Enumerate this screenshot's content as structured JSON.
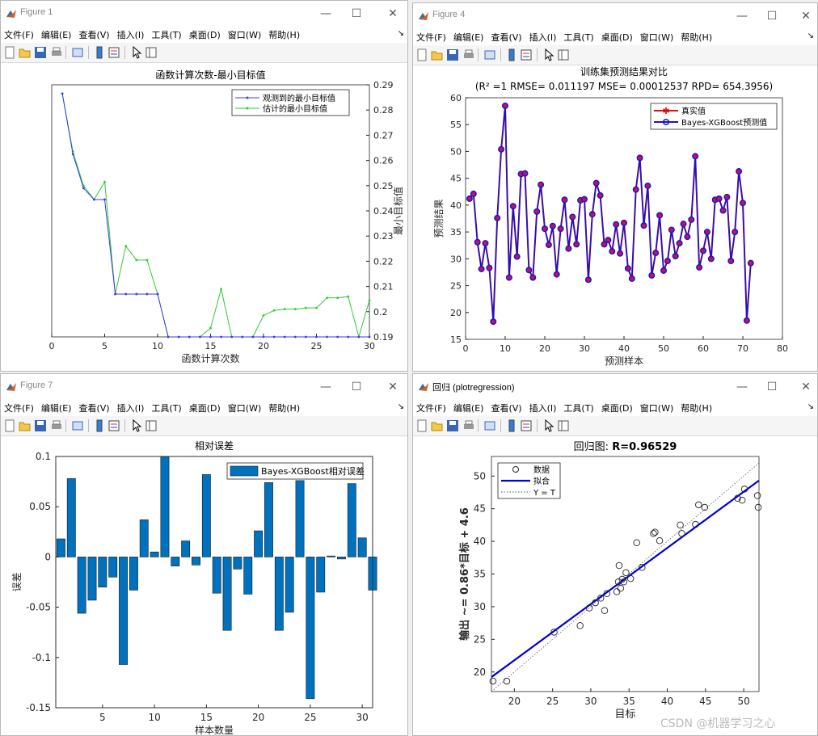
{
  "menu": [
    "文件(F)",
    "编辑(E)",
    "查看(V)",
    "插入(I)",
    "工具(T)",
    "桌面(D)",
    "窗口(W)",
    "帮助(H)"
  ],
  "window_controls": {
    "minimize": "—",
    "maximize": "☐",
    "close": "✕"
  },
  "figure1": {
    "window_title": "Figure 1",
    "chart_data": {
      "type": "line",
      "title": "函数计算次数-最小目标值",
      "xlabel": "函数计算次数",
      "ylabel": "最小目标值",
      "xlim": [
        0,
        30
      ],
      "ylim": [
        0.19,
        0.29
      ],
      "x_ticks": [
        "0",
        "5",
        "10",
        "15",
        "20",
        "25",
        "30"
      ],
      "y_ticks": [
        "0.19",
        "0.2",
        "0.21",
        "0.22",
        "0.23",
        "0.24",
        "0.25",
        "0.26",
        "0.27",
        "0.28",
        "0.29"
      ],
      "y_axis_side": "right",
      "legend_position": "top-right",
      "series": [
        {
          "name": "观测到的最小目标值",
          "color": "#3b3bf0",
          "marker": "dot",
          "x": [
            1,
            2,
            3,
            4,
            5,
            6,
            7,
            8,
            9,
            10,
            11,
            12,
            13,
            14,
            15,
            16,
            17,
            18,
            19,
            20,
            21,
            22,
            23,
            24,
            25,
            26,
            27,
            28,
            29,
            30
          ],
          "values": [
            0.2865,
            0.2625,
            0.249,
            0.2445,
            0.2445,
            0.207,
            0.207,
            0.207,
            0.207,
            0.207,
            0.19,
            0.19,
            0.19,
            0.19,
            0.19,
            0.19,
            0.19,
            0.19,
            0.19,
            0.19,
            0.19,
            0.19,
            0.19,
            0.19,
            0.19,
            0.19,
            0.19,
            0.19,
            0.19,
            0.19
          ]
        },
        {
          "name": "估计的最小目标值",
          "color": "#2ecc2e",
          "marker": "dot",
          "x": [
            1,
            2,
            3,
            4,
            5,
            6,
            7,
            8,
            9,
            10,
            11,
            12,
            13,
            14,
            15,
            16,
            17,
            18,
            19,
            20,
            21,
            22,
            23,
            24,
            25,
            26,
            27,
            28,
            29,
            30
          ],
          "values": [
            0.2865,
            0.2635,
            0.25,
            0.2445,
            0.2515,
            0.207,
            0.226,
            0.2205,
            0.2205,
            0.207,
            0.19,
            0.19,
            0.19,
            0.19,
            0.1935,
            0.209,
            0.19,
            0.19,
            0.19,
            0.1985,
            0.2005,
            0.201,
            0.201,
            0.2015,
            0.2015,
            0.2055,
            0.2055,
            0.206,
            0.19,
            0.2045
          ]
        }
      ]
    }
  },
  "figure4": {
    "window_title": "Figure 4",
    "chart_data": {
      "type": "line",
      "title": "训练集预测结果对比",
      "subtitle": "(R² =1 RMSE= 0.011197 MSE= 0.00012537 RPD= 654.3956)",
      "xlabel": "预测样本",
      "ylabel": "预测结果",
      "xlim": [
        0,
        80
      ],
      "ylim": [
        15,
        60
      ],
      "x_ticks": [
        "0",
        "10",
        "20",
        "30",
        "40",
        "50",
        "60",
        "70",
        "80"
      ],
      "y_ticks": [
        "15",
        "20",
        "25",
        "30",
        "35",
        "40",
        "45",
        "50",
        "55",
        "60"
      ],
      "legend_position": "top-right",
      "series": [
        {
          "name": "真实值",
          "color": "#e01010",
          "marker": "star"
        },
        {
          "name": "Bayes-XGBoost预测值",
          "color": "#1515d0",
          "marker": "circle"
        }
      ],
      "values": [
        41.2,
        42.1,
        33.1,
        28.1,
        32.9,
        28.3,
        18.3,
        37.6,
        50.4,
        58.5,
        26.5,
        39.8,
        30.4,
        45.8,
        45.9,
        27.9,
        26.5,
        38.8,
        43.8,
        35.6,
        32.6,
        36.1,
        27.1,
        35.6,
        41.0,
        31.9,
        37.8,
        32.7,
        40.9,
        41.1,
        26.1,
        38.3,
        44.1,
        41.8,
        32.7,
        33.5,
        31.4,
        36.4,
        31.0,
        36.7,
        28.2,
        26.3,
        42.9,
        48.8,
        36.2,
        43.6,
        26.9,
        31.1,
        38.1,
        27.8,
        29.6,
        35.4,
        30.5,
        32.9,
        36.5,
        34.1,
        37.3,
        49.1,
        28.4,
        31.5,
        35.0,
        30.0,
        41.0,
        41.2,
        39.0,
        41.5,
        29.6,
        35.0,
        46.3,
        40.4,
        18.5,
        29.2
      ]
    }
  },
  "figure7": {
    "window_title": "Figure 7",
    "chart_data": {
      "type": "bar",
      "title": "相对误差",
      "xlabel": "样本数量",
      "ylabel": "误差",
      "xlim": [
        0.5,
        31
      ],
      "ylim": [
        -0.15,
        0.1
      ],
      "x_ticks": [
        "5",
        "10",
        "15",
        "20",
        "25",
        "30"
      ],
      "y_ticks": [
        "-0.15",
        "-0.1",
        "-0.05",
        "0",
        "0.05",
        "0.1"
      ],
      "legend_position": "top-right",
      "series": [
        {
          "name": "Bayes-XGBoost相对误差",
          "color": "#0072bd"
        }
      ],
      "values": [
        0.018,
        0.078,
        -0.056,
        -0.043,
        -0.03,
        -0.02,
        -0.107,
        -0.033,
        0.037,
        0.005,
        0.1,
        -0.009,
        0.016,
        -0.008,
        0.082,
        -0.036,
        -0.073,
        -0.012,
        -0.037,
        0.026,
        0.074,
        -0.073,
        -0.055,
        0.076,
        -0.141,
        -0.035,
        0.001,
        -0.002,
        0.073,
        0.019,
        -0.033
      ]
    }
  },
  "regression": {
    "window_title": "回归 (plotregression)",
    "chart_data": {
      "type": "scatter",
      "title_prefix": "回归图: ",
      "title_value": "R=0.96529",
      "xlabel": "目标",
      "ylabel": "输出 ~= 0.86*目标 + 4.6",
      "xlim": [
        17,
        52
      ],
      "ylim": [
        17,
        53
      ],
      "x_ticks": [
        "20",
        "25",
        "30",
        "35",
        "40",
        "45",
        "50"
      ],
      "y_ticks": [
        "20",
        "25",
        "30",
        "35",
        "40",
        "45",
        "50"
      ],
      "legend_position": "top-left",
      "legend": [
        "数据",
        "拟合",
        "Y = T"
      ],
      "fit": {
        "slope": 0.86,
        "intercept": 4.6,
        "color": "#0000d8"
      },
      "points": [
        [
          17.2,
          18.6
        ],
        [
          19.0,
          18.6
        ],
        [
          25.2,
          26.1
        ],
        [
          28.6,
          27.1
        ],
        [
          29.8,
          29.8
        ],
        [
          30.6,
          30.6
        ],
        [
          31.3,
          31.3
        ],
        [
          31.8,
          29.4
        ],
        [
          32.1,
          32.0
        ],
        [
          33.4,
          32.3
        ],
        [
          33.6,
          33.8
        ],
        [
          33.7,
          36.3
        ],
        [
          33.9,
          32.8
        ],
        [
          34.1,
          34.2
        ],
        [
          34.3,
          33.8
        ],
        [
          34.6,
          35.2
        ],
        [
          35.2,
          34.3
        ],
        [
          36.0,
          39.8
        ],
        [
          36.7,
          36.0
        ],
        [
          38.2,
          41.2
        ],
        [
          38.4,
          41.4
        ],
        [
          39.0,
          40.1
        ],
        [
          41.7,
          42.5
        ],
        [
          41.9,
          41.2
        ],
        [
          43.7,
          42.6
        ],
        [
          44.1,
          45.6
        ],
        [
          44.9,
          45.2
        ],
        [
          49.2,
          46.6
        ],
        [
          49.8,
          46.3
        ],
        [
          50.1,
          48.0
        ],
        [
          51.8,
          47.0
        ],
        [
          51.9,
          45.2
        ]
      ]
    }
  },
  "watermark": "CSDN @机器学习之心"
}
